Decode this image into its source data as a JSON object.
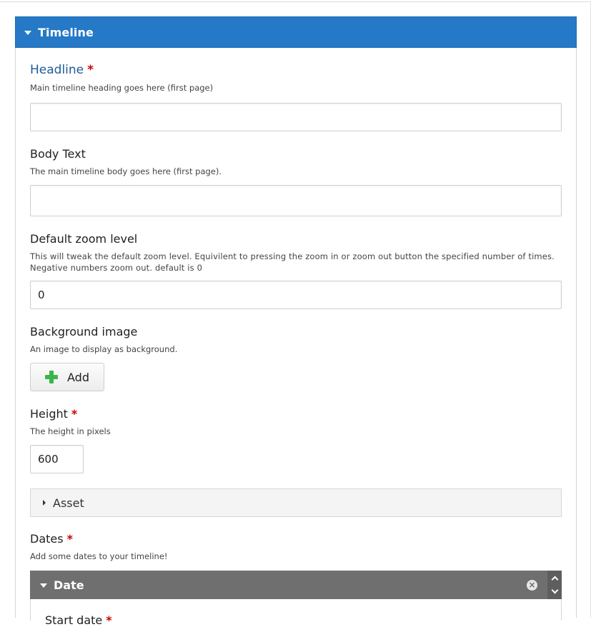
{
  "group": {
    "title": "Timeline"
  },
  "fields": {
    "headline": {
      "label": "Headline",
      "required": "*",
      "description": "Main timeline heading goes here (first page)",
      "value": ""
    },
    "body_text": {
      "label": "Body Text",
      "description": "The main timeline body goes here (first page).",
      "value": ""
    },
    "default_zoom": {
      "label": "Default zoom level",
      "description": "This will tweak the default zoom level. Equivilent to pressing the zoom in or zoom out button the specified number of times. Negative numbers zoom out. default is 0",
      "value": "0"
    },
    "background_image": {
      "label": "Background image",
      "description": "An image to display as background.",
      "button_label": "Add"
    },
    "height": {
      "label": "Height",
      "required": "*",
      "description": "The height in pixels",
      "value": "600"
    },
    "asset": {
      "label": "Asset"
    },
    "dates": {
      "label": "Dates",
      "required": "*",
      "description": "Add some dates to your timeline!",
      "item_title": "Date",
      "item_close": "×",
      "first_field_label": "Start date",
      "first_field_required": "*"
    }
  }
}
